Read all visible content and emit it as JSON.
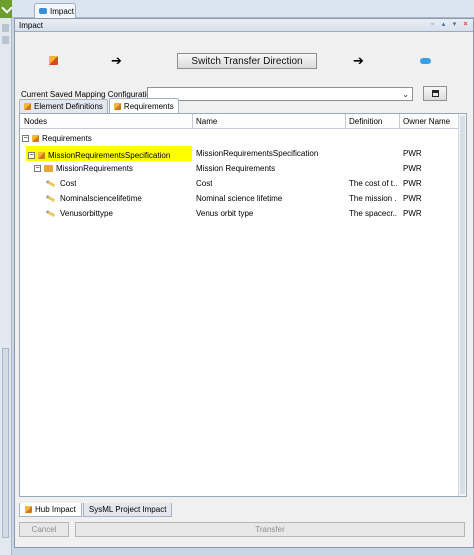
{
  "window": {
    "tab_label": "Impact",
    "panel_title": "Impact"
  },
  "direction": {
    "switch_label": "Switch Transfer Direction",
    "left_arrow": "➔",
    "right_arrow": "➔"
  },
  "mapping": {
    "label": "Current Saved Mapping Configuration",
    "selected_value": ""
  },
  "tabs": [
    {
      "label": "Element Definitions",
      "active": false
    },
    {
      "label": "Requirements",
      "active": true
    }
  ],
  "tree": {
    "columns": [
      "Nodes",
      "Name",
      "Definition",
      "Owner Name"
    ],
    "rows": [
      {
        "node": "Requirements",
        "name": "",
        "definition": "",
        "owner": "",
        "expander": "−",
        "icon": "cube-icon"
      },
      {
        "node": "MissionRequirementsSpecification",
        "name": "MissionRequirementsSpecification",
        "definition": "",
        "owner": "PWR",
        "expander": "−",
        "icon": "cube-icon",
        "highlighted": true
      },
      {
        "node": "MissionRequirements",
        "name": "Mission Requirements",
        "definition": "",
        "owner": "PWR",
        "expander": "−",
        "icon": "folder-icon"
      },
      {
        "node": "Cost",
        "name": "Cost",
        "definition": "The cost of t...",
        "owner": "PWR",
        "expander": "",
        "icon": "pencil-icon"
      },
      {
        "node": "Nominalsciencelifetime",
        "name": "Nominal science lifetime",
        "definition": "The mission ...",
        "owner": "PWR",
        "expander": "",
        "icon": "pencil-icon"
      },
      {
        "node": "Venusorbittype",
        "name": "Venus orbit type",
        "definition": "The spacecr...",
        "owner": "PWR",
        "expander": "",
        "icon": "pencil-icon"
      }
    ]
  },
  "bottom_tabs": [
    {
      "label": "Hub Impact",
      "active": true
    },
    {
      "label": "SysML Project Impact",
      "active": false
    }
  ],
  "footer": {
    "cancel_label": "Cancel",
    "transfer_label": "Transfer"
  },
  "header_icons": [
    "restore-icon",
    "pin-icon",
    "menu-icon",
    "close-icon"
  ],
  "colors": {
    "highlight": "#ffff00",
    "accent": "#39a0e8"
  }
}
